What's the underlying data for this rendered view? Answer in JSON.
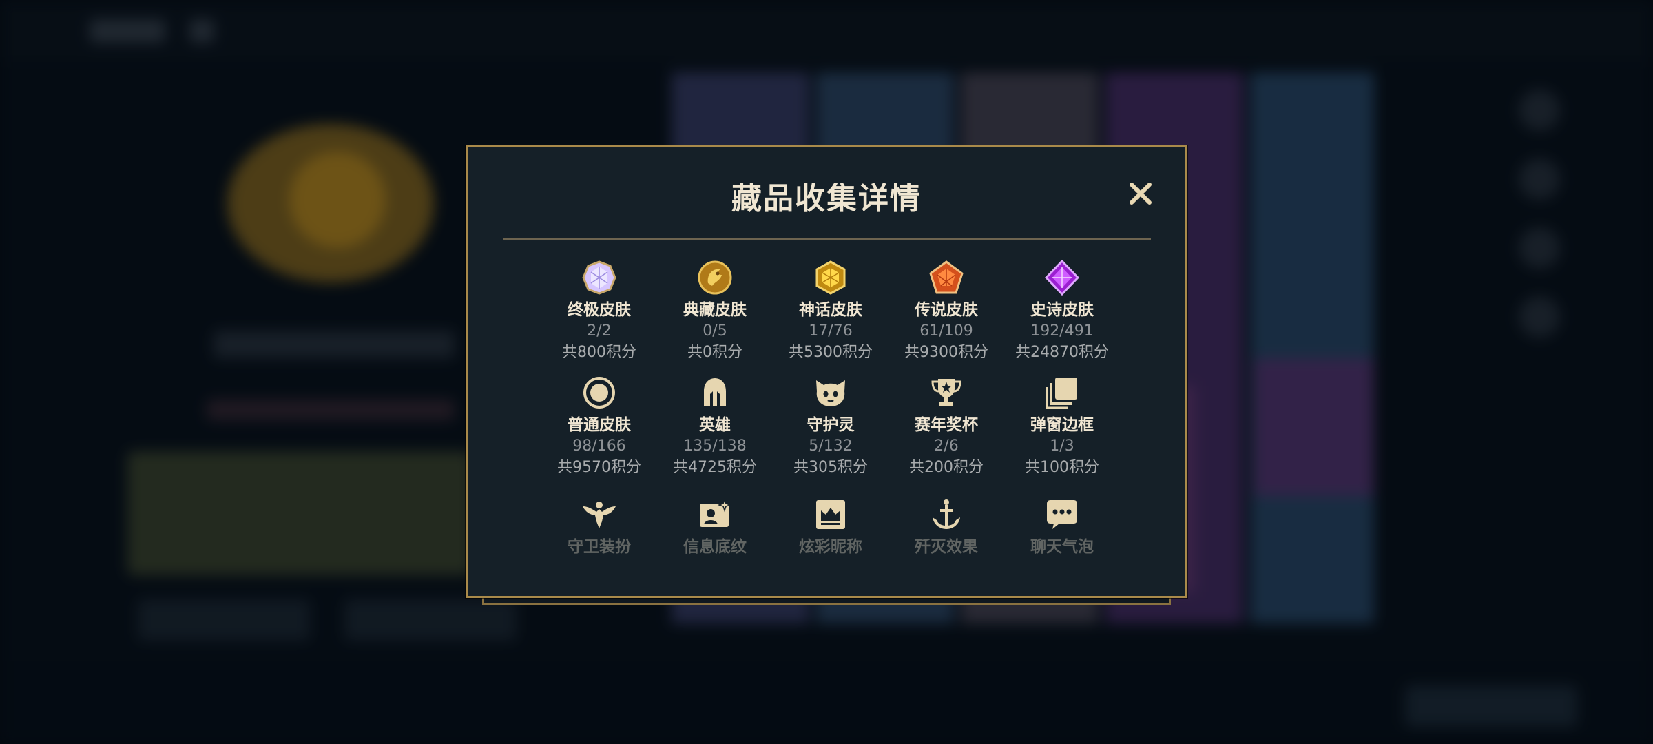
{
  "dialog": {
    "title": "藏品收集详情",
    "close_icon": "close-icon"
  },
  "colors": {
    "gold": "#c8aa6e",
    "title_text": "#f0e6d2",
    "panel_bg": "#152028",
    "border": "#a98a4a",
    "count_text": "#8e9296"
  },
  "items": [
    {
      "label": "终极皮肤",
      "count": "2/2",
      "points": "共800积分",
      "icon": "ultimate-skin-gem-icon"
    },
    {
      "label": "典藏皮肤",
      "count": "0/5",
      "points": "共0积分",
      "icon": "prestige-skin-icon"
    },
    {
      "label": "神话皮肤",
      "count": "17/76",
      "points": "共5300积分",
      "icon": "mythic-skin-gem-icon"
    },
    {
      "label": "传说皮肤",
      "count": "61/109",
      "points": "共9300积分",
      "icon": "legendary-skin-gem-icon"
    },
    {
      "label": "史诗皮肤",
      "count": "192/491",
      "points": "共24870积分",
      "icon": "epic-skin-gem-icon"
    },
    {
      "label": "普通皮肤",
      "count": "98/166",
      "points": "共9570积分",
      "icon": "standard-skin-ring-icon"
    },
    {
      "label": "英雄",
      "count": "135/138",
      "points": "共4725积分",
      "icon": "champion-helmet-icon"
    },
    {
      "label": "守护灵",
      "count": "5/132",
      "points": "共305积分",
      "icon": "guardian-pet-icon"
    },
    {
      "label": "赛年奖杯",
      "count": "2/6",
      "points": "共200积分",
      "icon": "trophy-icon"
    },
    {
      "label": "弹窗边框",
      "count": "1/3",
      "points": "共100积分",
      "icon": "popup-frame-icon"
    },
    {
      "label": "守卫装扮",
      "icon": "ward-skin-icon"
    },
    {
      "label": "信息底纹",
      "icon": "info-card-icon"
    },
    {
      "label": "炫彩昵称",
      "icon": "nickname-crown-icon"
    },
    {
      "label": "歼灭效果",
      "icon": "finisher-anchor-icon"
    },
    {
      "label": "聊天气泡",
      "icon": "chat-bubble-icon"
    }
  ]
}
